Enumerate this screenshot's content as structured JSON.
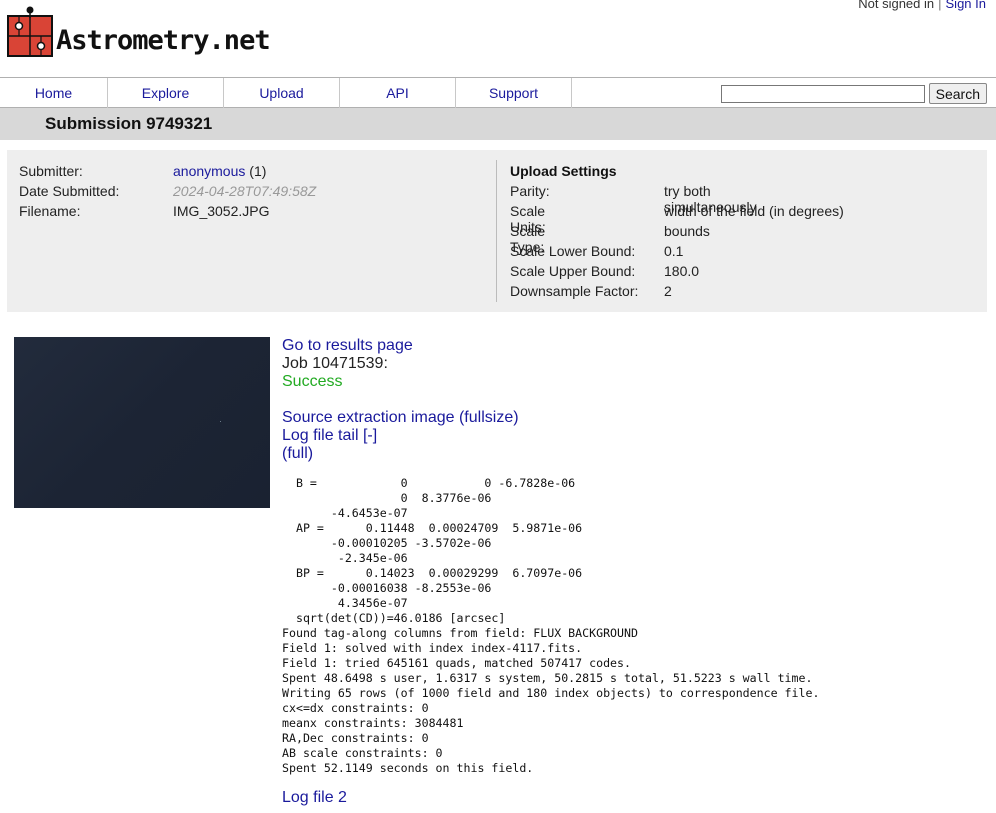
{
  "auth": {
    "status": "Not signed in",
    "separator": "|",
    "signin": "Sign In"
  },
  "brand": {
    "name": "Astrometry.net",
    "logo_color": "#d94436"
  },
  "nav": {
    "items": [
      "Home",
      "Explore",
      "Upload",
      "API",
      "Support"
    ],
    "search_value": "",
    "search_button": "Search"
  },
  "page": {
    "title": "Submission 9749321"
  },
  "submission": {
    "submitter_label": "Submitter:",
    "submitter_name": "anonymous",
    "submitter_count": "(1)",
    "date_label": "Date Submitted:",
    "date_value": "2024-04-28T07:49:58Z",
    "filename_label": "Filename:",
    "filename_value": "IMG_3052.JPG"
  },
  "upload_settings": {
    "title": "Upload Settings",
    "rows": [
      {
        "label": "Parity:",
        "value": "try both simultaneously"
      },
      {
        "label": "Scale Units:",
        "value": "width of the field (in degrees)"
      },
      {
        "label": "Scale Type:",
        "value": "bounds"
      },
      {
        "label": "Scale Lower Bound:",
        "value": "0.1"
      },
      {
        "label": "Scale Upper Bound:",
        "value": "180.0"
      },
      {
        "label": "Downsample Factor:",
        "value": "2"
      }
    ]
  },
  "job": {
    "results_link": "Go to results page",
    "job_label": "Job 10471539",
    "job_colon": ":",
    "status": "Success",
    "status_color": "#22aa22",
    "source_extraction_link": "Source extraction image (fullsize)",
    "log_tail_link": "Log file tail [-]",
    "log_full_link": "(full)",
    "log_lines": [
      "  B =            0           0 -6.7828e-06",
      "                 0  8.3776e-06",
      "       -4.6453e-07",
      "  AP =      0.11448  0.00024709  5.9871e-06",
      "       -0.00010205 -3.5702e-06",
      "        -2.345e-06",
      "  BP =      0.14023  0.00029299  6.7097e-06",
      "       -0.00016038 -8.2553e-06",
      "        4.3456e-07",
      "  sqrt(det(CD))=46.0186 [arcsec]",
      "Found tag-along columns from field: FLUX BACKGROUND",
      "Field 1: solved with index index-4117.fits.",
      "Field 1: tried 645161 quads, matched 507417 codes.",
      "Spent 48.6498 s user, 1.6317 s system, 50.2815 s total, 51.5223 s wall time.",
      "Writing 65 rows (of 1000 field and 180 index objects) to correspondence file.",
      "cx<=dx constraints: 0",
      "meanx constraints: 3084481",
      "RA,Dec constraints: 0",
      "AB scale constraints: 0",
      "Spent 52.1149 seconds on this field."
    ],
    "log_file2_link": "Log file 2"
  }
}
